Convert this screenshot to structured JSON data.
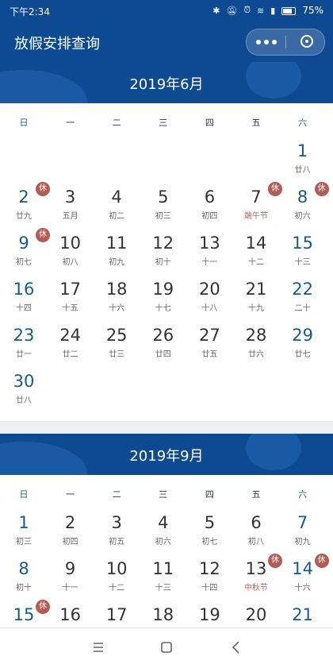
{
  "status_bar": {
    "time": "下午2:34",
    "battery": "75%"
  },
  "nav": {
    "title": "放假安排查询"
  },
  "weekdays": [
    "日",
    "一",
    "二",
    "三",
    "四",
    "五",
    "六"
  ],
  "badge_text": "休",
  "months": [
    {
      "title": "2019年6月",
      "first_col": 6,
      "days": [
        {
          "d": "1",
          "l": "廿八"
        },
        {
          "d": "2",
          "l": "廿九",
          "rest": true
        },
        {
          "d": "3",
          "l": "五月"
        },
        {
          "d": "4",
          "l": "初二"
        },
        {
          "d": "5",
          "l": "初三"
        },
        {
          "d": "6",
          "l": "初四"
        },
        {
          "d": "7",
          "l": "端午节",
          "rest": true,
          "festival": true
        },
        {
          "d": "8",
          "l": "初六",
          "rest": true
        },
        {
          "d": "9",
          "l": "初七",
          "rest": true
        },
        {
          "d": "10",
          "l": "初八"
        },
        {
          "d": "11",
          "l": "初九"
        },
        {
          "d": "12",
          "l": "初十"
        },
        {
          "d": "13",
          "l": "十一"
        },
        {
          "d": "14",
          "l": "十二"
        },
        {
          "d": "15",
          "l": "十三"
        },
        {
          "d": "16",
          "l": "十四"
        },
        {
          "d": "17",
          "l": "十五"
        },
        {
          "d": "18",
          "l": "十六"
        },
        {
          "d": "19",
          "l": "十七"
        },
        {
          "d": "20",
          "l": "十八"
        },
        {
          "d": "21",
          "l": "十九"
        },
        {
          "d": "22",
          "l": "二十"
        },
        {
          "d": "23",
          "l": "廿一"
        },
        {
          "d": "24",
          "l": "廿二"
        },
        {
          "d": "25",
          "l": "廿三"
        },
        {
          "d": "26",
          "l": "廿四"
        },
        {
          "d": "27",
          "l": "廿五"
        },
        {
          "d": "28",
          "l": "廿六"
        },
        {
          "d": "29",
          "l": "廿七"
        },
        {
          "d": "30",
          "l": "廿八"
        }
      ]
    },
    {
      "title": "2019年9月",
      "first_col": 0,
      "days": [
        {
          "d": "1",
          "l": "初三"
        },
        {
          "d": "2",
          "l": "初四"
        },
        {
          "d": "3",
          "l": "初五"
        },
        {
          "d": "4",
          "l": "初六"
        },
        {
          "d": "5",
          "l": "初七"
        },
        {
          "d": "6",
          "l": "初八"
        },
        {
          "d": "7",
          "l": "初九"
        },
        {
          "d": "8",
          "l": "初十"
        },
        {
          "d": "9",
          "l": "十一"
        },
        {
          "d": "10",
          "l": "十二"
        },
        {
          "d": "11",
          "l": "十三"
        },
        {
          "d": "12",
          "l": "十四"
        },
        {
          "d": "13",
          "l": "中秋节",
          "rest": true,
          "festival": true
        },
        {
          "d": "14",
          "l": "十六",
          "rest": true
        },
        {
          "d": "15",
          "l": "",
          "rest": true
        },
        {
          "d": "16",
          "l": ""
        },
        {
          "d": "17",
          "l": ""
        },
        {
          "d": "18",
          "l": ""
        },
        {
          "d": "19",
          "l": ""
        },
        {
          "d": "20",
          "l": ""
        },
        {
          "d": "21",
          "l": ""
        }
      ]
    }
  ],
  "colors": {
    "primary": "#0e4a91",
    "weekend_num": "#1b5a83",
    "badge": "#b35b55",
    "festival_text": "#b06a63"
  },
  "icons": {
    "bottom": [
      "menu-icon",
      "home-square-icon",
      "back-chevron-icon"
    ]
  }
}
